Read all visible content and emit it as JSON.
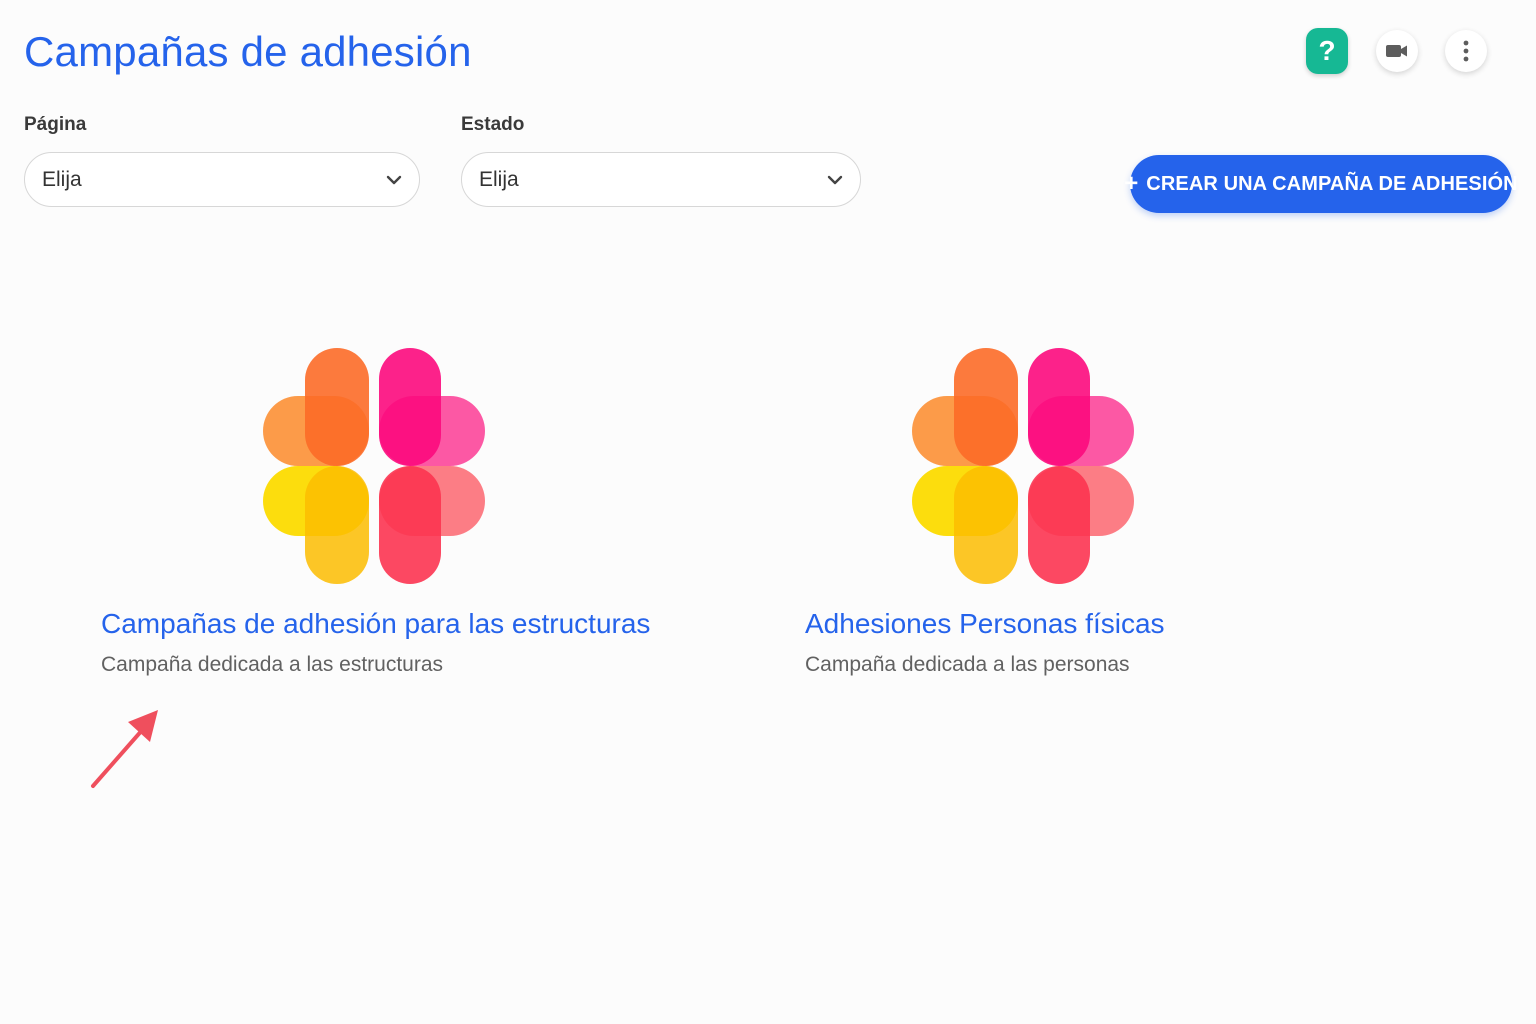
{
  "header": {
    "title": "Campañas de adhesión",
    "help_label": "?"
  },
  "filters": [
    {
      "label": "Página",
      "value": "Elija"
    },
    {
      "label": "Estado",
      "value": "Elija"
    }
  ],
  "actions": {
    "create_label": "CREAR UNA CAMPAÑA DE ADHESIÓN",
    "create_icon": "+"
  },
  "campaigns": [
    {
      "title": "Campañas de adhesión para las estructuras",
      "subtitle": "Campaña dedicada a las estructuras"
    },
    {
      "title": "Adhesiones Personas físicas",
      "subtitle": "Campaña dedicada a las personas"
    }
  ],
  "colors": {
    "accent": "#2563eb",
    "help": "#16b894",
    "arrow": "#ef4f5d"
  }
}
